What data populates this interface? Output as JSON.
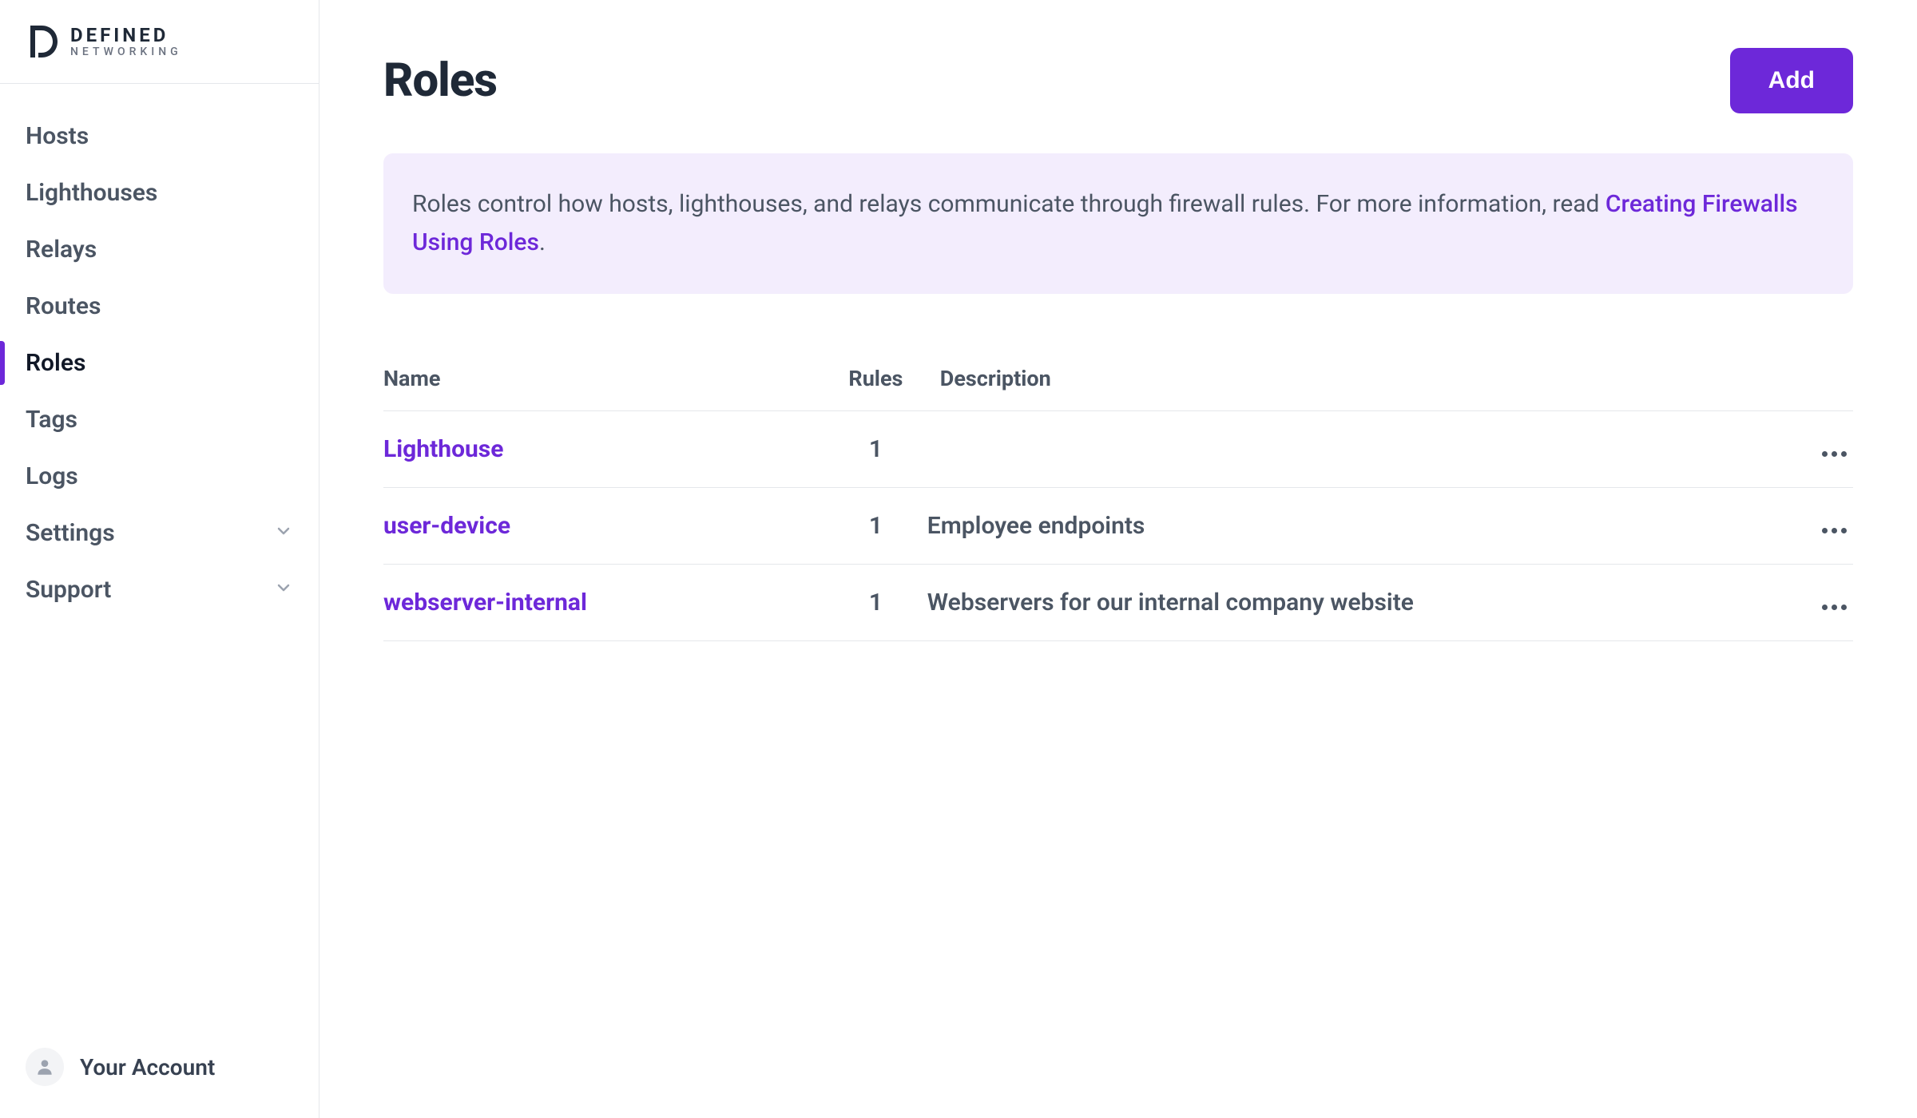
{
  "brand": {
    "name": "DEFINED",
    "sub": "NETWORKING"
  },
  "sidebar": {
    "items": [
      {
        "label": "Hosts"
      },
      {
        "label": "Lighthouses"
      },
      {
        "label": "Relays"
      },
      {
        "label": "Routes"
      },
      {
        "label": "Roles"
      },
      {
        "label": "Tags"
      },
      {
        "label": "Logs"
      },
      {
        "label": "Settings"
      },
      {
        "label": "Support"
      }
    ],
    "account_label": "Your Account"
  },
  "page": {
    "title": "Roles",
    "add_label": "Add",
    "banner_text": "Roles control how hosts, lighthouses, and relays communicate through firewall rules. For more information, read ",
    "banner_link": "Creating Firewalls Using Roles",
    "banner_after": "."
  },
  "table": {
    "headers": {
      "name": "Name",
      "rules": "Rules",
      "description": "Description"
    },
    "rows": [
      {
        "name": "Lighthouse",
        "rules": "1",
        "description": ""
      },
      {
        "name": "user-device",
        "rules": "1",
        "description": "Employee endpoints"
      },
      {
        "name": "webserver-internal",
        "rules": "1",
        "description": "Webservers for our internal company website"
      }
    ]
  }
}
